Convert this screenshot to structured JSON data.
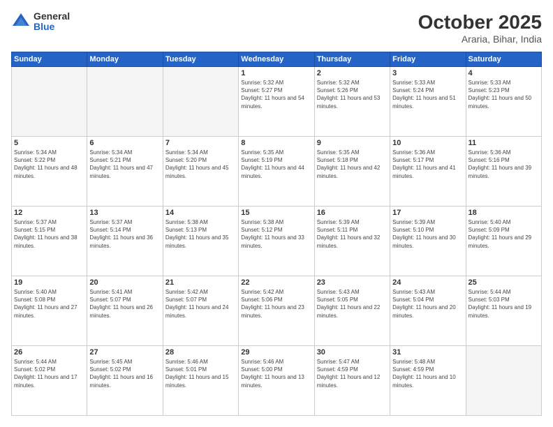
{
  "header": {
    "logo_general": "General",
    "logo_blue": "Blue",
    "title": "October 2025",
    "subtitle": "Araria, Bihar, India"
  },
  "days_of_week": [
    "Sunday",
    "Monday",
    "Tuesday",
    "Wednesday",
    "Thursday",
    "Friday",
    "Saturday"
  ],
  "weeks": [
    [
      {
        "day": "",
        "empty": true
      },
      {
        "day": "",
        "empty": true
      },
      {
        "day": "",
        "empty": true
      },
      {
        "day": "1",
        "sunrise": "5:32 AM",
        "sunset": "5:27 PM",
        "daylight": "11 hours and 54 minutes."
      },
      {
        "day": "2",
        "sunrise": "5:32 AM",
        "sunset": "5:26 PM",
        "daylight": "11 hours and 53 minutes."
      },
      {
        "day": "3",
        "sunrise": "5:33 AM",
        "sunset": "5:24 PM",
        "daylight": "11 hours and 51 minutes."
      },
      {
        "day": "4",
        "sunrise": "5:33 AM",
        "sunset": "5:23 PM",
        "daylight": "11 hours and 50 minutes."
      }
    ],
    [
      {
        "day": "5",
        "sunrise": "5:34 AM",
        "sunset": "5:22 PM",
        "daylight": "11 hours and 48 minutes."
      },
      {
        "day": "6",
        "sunrise": "5:34 AM",
        "sunset": "5:21 PM",
        "daylight": "11 hours and 47 minutes."
      },
      {
        "day": "7",
        "sunrise": "5:34 AM",
        "sunset": "5:20 PM",
        "daylight": "11 hours and 45 minutes."
      },
      {
        "day": "8",
        "sunrise": "5:35 AM",
        "sunset": "5:19 PM",
        "daylight": "11 hours and 44 minutes."
      },
      {
        "day": "9",
        "sunrise": "5:35 AM",
        "sunset": "5:18 PM",
        "daylight": "11 hours and 42 minutes."
      },
      {
        "day": "10",
        "sunrise": "5:36 AM",
        "sunset": "5:17 PM",
        "daylight": "11 hours and 41 minutes."
      },
      {
        "day": "11",
        "sunrise": "5:36 AM",
        "sunset": "5:16 PM",
        "daylight": "11 hours and 39 minutes."
      }
    ],
    [
      {
        "day": "12",
        "sunrise": "5:37 AM",
        "sunset": "5:15 PM",
        "daylight": "11 hours and 38 minutes."
      },
      {
        "day": "13",
        "sunrise": "5:37 AM",
        "sunset": "5:14 PM",
        "daylight": "11 hours and 36 minutes."
      },
      {
        "day": "14",
        "sunrise": "5:38 AM",
        "sunset": "5:13 PM",
        "daylight": "11 hours and 35 minutes."
      },
      {
        "day": "15",
        "sunrise": "5:38 AM",
        "sunset": "5:12 PM",
        "daylight": "11 hours and 33 minutes."
      },
      {
        "day": "16",
        "sunrise": "5:39 AM",
        "sunset": "5:11 PM",
        "daylight": "11 hours and 32 minutes."
      },
      {
        "day": "17",
        "sunrise": "5:39 AM",
        "sunset": "5:10 PM",
        "daylight": "11 hours and 30 minutes."
      },
      {
        "day": "18",
        "sunrise": "5:40 AM",
        "sunset": "5:09 PM",
        "daylight": "11 hours and 29 minutes."
      }
    ],
    [
      {
        "day": "19",
        "sunrise": "5:40 AM",
        "sunset": "5:08 PM",
        "daylight": "11 hours and 27 minutes."
      },
      {
        "day": "20",
        "sunrise": "5:41 AM",
        "sunset": "5:07 PM",
        "daylight": "11 hours and 26 minutes."
      },
      {
        "day": "21",
        "sunrise": "5:42 AM",
        "sunset": "5:07 PM",
        "daylight": "11 hours and 24 minutes."
      },
      {
        "day": "22",
        "sunrise": "5:42 AM",
        "sunset": "5:06 PM",
        "daylight": "11 hours and 23 minutes."
      },
      {
        "day": "23",
        "sunrise": "5:43 AM",
        "sunset": "5:05 PM",
        "daylight": "11 hours and 22 minutes."
      },
      {
        "day": "24",
        "sunrise": "5:43 AM",
        "sunset": "5:04 PM",
        "daylight": "11 hours and 20 minutes."
      },
      {
        "day": "25",
        "sunrise": "5:44 AM",
        "sunset": "5:03 PM",
        "daylight": "11 hours and 19 minutes."
      }
    ],
    [
      {
        "day": "26",
        "sunrise": "5:44 AM",
        "sunset": "5:02 PM",
        "daylight": "11 hours and 17 minutes."
      },
      {
        "day": "27",
        "sunrise": "5:45 AM",
        "sunset": "5:02 PM",
        "daylight": "11 hours and 16 minutes."
      },
      {
        "day": "28",
        "sunrise": "5:46 AM",
        "sunset": "5:01 PM",
        "daylight": "11 hours and 15 minutes."
      },
      {
        "day": "29",
        "sunrise": "5:46 AM",
        "sunset": "5:00 PM",
        "daylight": "11 hours and 13 minutes."
      },
      {
        "day": "30",
        "sunrise": "5:47 AM",
        "sunset": "4:59 PM",
        "daylight": "11 hours and 12 minutes."
      },
      {
        "day": "31",
        "sunrise": "5:48 AM",
        "sunset": "4:59 PM",
        "daylight": "11 hours and 10 minutes."
      },
      {
        "day": "",
        "empty": true
      }
    ]
  ]
}
